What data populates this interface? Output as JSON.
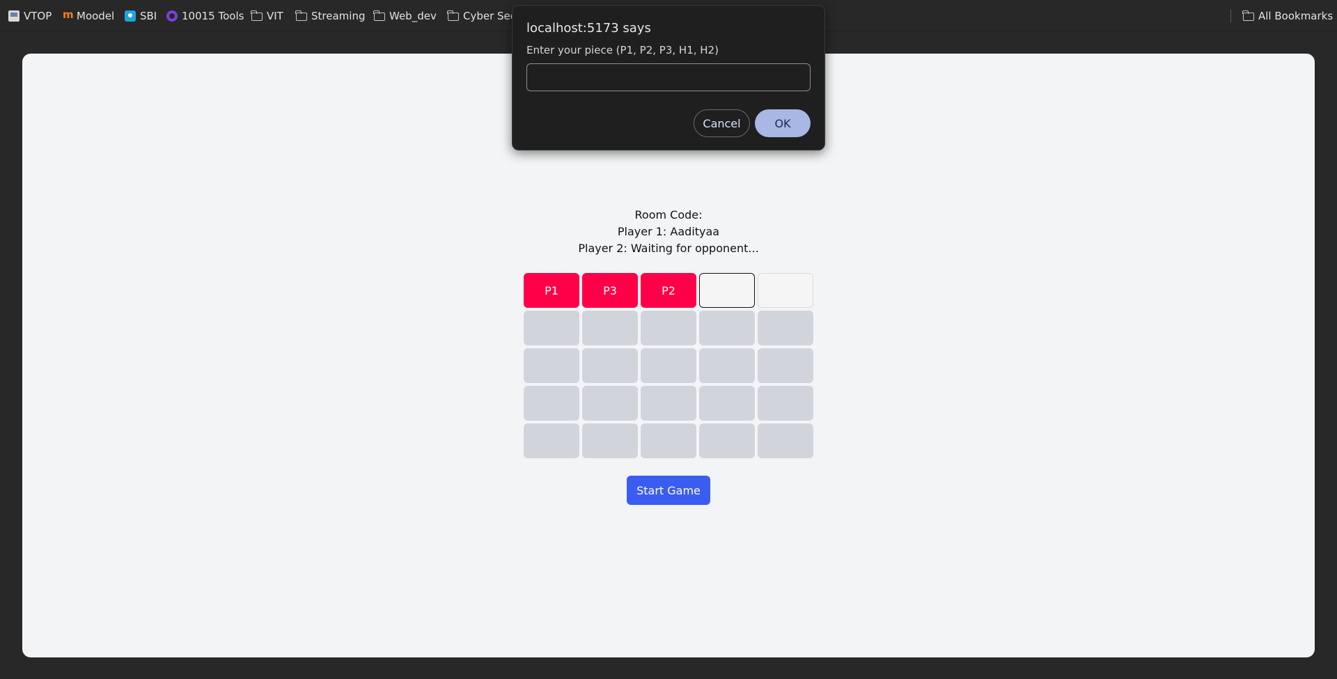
{
  "bookmarks": {
    "items": [
      {
        "label": "VTOP"
      },
      {
        "label": "Moodel"
      },
      {
        "label": "SBI"
      },
      {
        "label": "10015 Tools"
      },
      {
        "label": "VIT"
      },
      {
        "label": "Streaming"
      },
      {
        "label": "Web_dev"
      },
      {
        "label": "Cyber Sec"
      }
    ],
    "all_bookmarks": "All Bookmarks"
  },
  "room": {
    "room_code_label": "Room Code:",
    "player1": "Player 1: Aadityaa",
    "player2": "Player 2: Waiting for opponent..."
  },
  "board": {
    "rows": [
      [
        "P1",
        "P3",
        "P2",
        "",
        ""
      ],
      [
        "",
        "",
        "",
        "",
        ""
      ],
      [
        "",
        "",
        "",
        "",
        ""
      ],
      [
        "",
        "",
        "",
        "",
        ""
      ],
      [
        "",
        "",
        "",
        "",
        ""
      ]
    ]
  },
  "start_button": "Start Game",
  "dialog": {
    "title": "localhost:5173 says",
    "message": "Enter your piece (P1, P2, P3, H1, H2)",
    "input_value": "",
    "cancel": "Cancel",
    "ok": "OK"
  },
  "colors": {
    "piece": "#ff0048",
    "start_button": "#3b5cf0",
    "ok_button": "#a8b7e4"
  }
}
